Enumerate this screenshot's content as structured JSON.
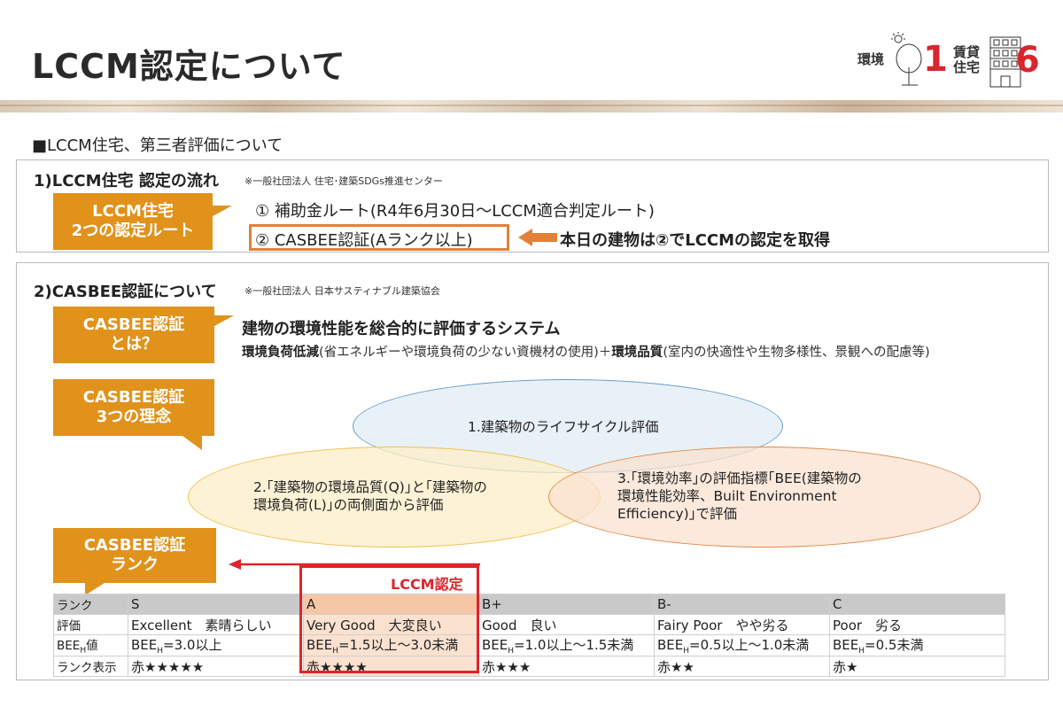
{
  "page": {
    "title": "LCCM認定について",
    "logo": {
      "env_label": "環境",
      "env_number": "1",
      "rent_label": "賃貸住宅",
      "rent_number": "6"
    },
    "section_heading": "■LCCM住宅、第三者評価について"
  },
  "box1": {
    "title": "1)LCCM住宅 認定の流れ",
    "note": "※一般社団法人 住宅･建築SDGs推進センター",
    "callout": [
      "LCCM住宅",
      "2つの認定ルート"
    ],
    "route1": "① 補助金ルート(R4年6月30日～LCCM適合判定ルート)",
    "route2": "② CASBEE認証(Aランク以上)",
    "arrow_text": "本日の建物は②でLCCMの認定を取得"
  },
  "box2": {
    "title": "2)CASBEE認証について",
    "note": "※一般社団法人 日本サスティナブル建築協会",
    "callout_what": [
      "CASBEE認証",
      "とは？"
    ],
    "headline": "建物の環境性能を総合的に評価するシステム",
    "subline_bold1": "環境負荷低減",
    "subline_text1": "(省エネルギーや環境負荷の少ない資機材の使用)＋",
    "subline_bold2": "環境品質",
    "subline_text2": "(室内の快適性や生物多様性、景観への配慮等)",
    "callout_principle": [
      "CASBEE認証",
      "3つの理念"
    ],
    "principle1": "1.建築物のライフサイクル評価",
    "principle2": [
      "2.｢建築物の環境品質(Q)｣と｢建築物の",
      "環境負荷(L)｣の両側面から評価"
    ],
    "principle3": [
      "3.｢環境効率｣の評価指標｢BEE(建築物の",
      "環境性能効率、Built Environment",
      "Efficiency)｣で評価"
    ],
    "callout_rank": [
      "CASBEE認証",
      "ランク"
    ],
    "lccm_label": "LCCM認定"
  },
  "rank_table": {
    "row_labels": [
      "ランク",
      "評価",
      "BEE値",
      "ランク表示"
    ],
    "bee_sub": "H",
    "columns": [
      {
        "rank": "S",
        "eval": "Excellent　素晴らしい",
        "bee": "=3.0以上",
        "stars": "赤★★★★★"
      },
      {
        "rank": "A",
        "eval": "Very Good　大変良い",
        "bee": "=1.5以上～3.0未満",
        "stars": "赤★★★★"
      },
      {
        "rank": "B+",
        "eval": "Good　良い",
        "bee": "=1.0以上～1.5未満",
        "stars": "赤★★★"
      },
      {
        "rank": "B-",
        "eval": "Fairy Poor　やや劣る",
        "bee": "=0.5以上～1.0未満",
        "stars": "赤★★"
      },
      {
        "rank": "C",
        "eval": "Poor　劣る",
        "bee": "=0.5未満",
        "stars": "赤★"
      }
    ]
  },
  "colors": {
    "callout": "#e0921b",
    "highlight_red": "#e0242b",
    "route_box": "#e2803a"
  }
}
